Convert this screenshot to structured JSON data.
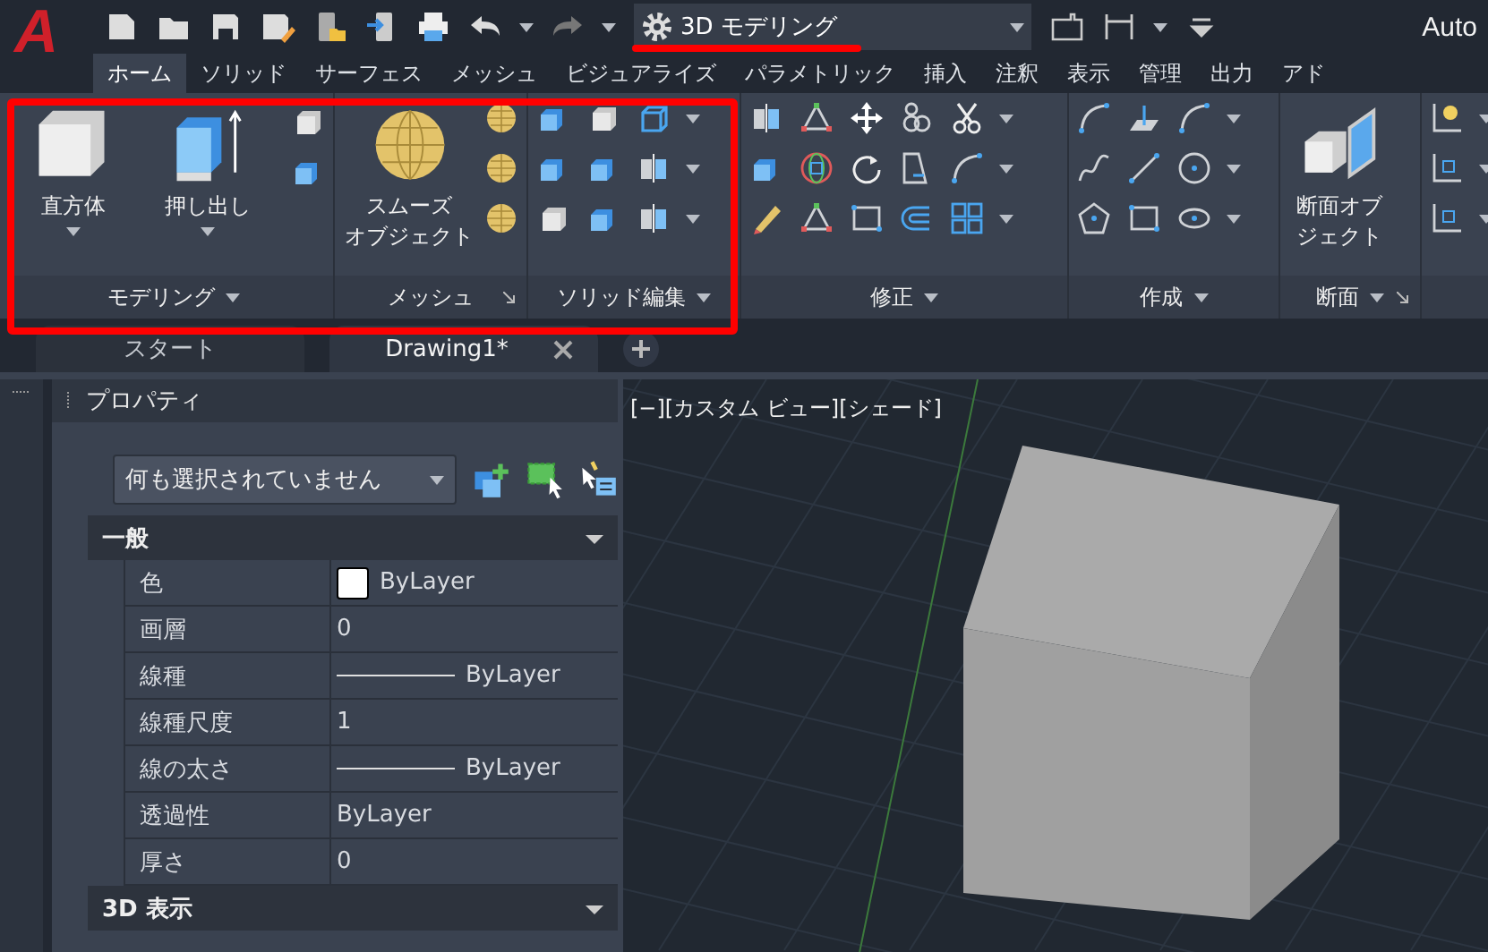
{
  "app_logo": "A",
  "workspace": {
    "value": "3D モデリング"
  },
  "title": "Auto",
  "ribbon_tabs": [
    {
      "label": "ホーム",
      "selected": true
    },
    {
      "label": "ソリッド",
      "selected": false
    },
    {
      "label": "サーフェス",
      "selected": false
    },
    {
      "label": "メッシュ",
      "selected": false
    },
    {
      "label": "ビジュアライズ",
      "selected": false
    },
    {
      "label": "パラメトリック",
      "selected": false
    },
    {
      "label": "挿入",
      "selected": false
    },
    {
      "label": "注釈",
      "selected": false
    },
    {
      "label": "表示",
      "selected": false
    },
    {
      "label": "管理",
      "selected": false
    },
    {
      "label": "出力",
      "selected": false
    },
    {
      "label": "アド",
      "selected": false
    }
  ],
  "ribbon_panels": [
    {
      "title": "モデリング",
      "menu": true,
      "launcher": false,
      "buttons": [
        {
          "label": "直方体",
          "dropdown": true
        },
        {
          "label": "押し出し",
          "dropdown": true
        }
      ]
    },
    {
      "title": "メッシュ",
      "menu": false,
      "launcher": true,
      "buttons": [
        {
          "lines": [
            "スムーズ",
            "オブジェクト"
          ],
          "dropdown": false
        }
      ]
    },
    {
      "title": "ソリッド編集",
      "menu": true,
      "launcher": false
    },
    {
      "title": "修正",
      "menu": true,
      "launcher": false
    },
    {
      "title": "作成",
      "menu": true,
      "launcher": false
    },
    {
      "title": "断面",
      "menu": true,
      "launcher": true,
      "buttons": [
        {
          "lines": [
            "断面オブ",
            "ジェクト"
          ],
          "dropdown": false
        }
      ]
    }
  ],
  "doc_tabs": [
    {
      "label": "スタート",
      "selected": false,
      "closable": false
    },
    {
      "label": "Drawing1*",
      "selected": true,
      "closable": true
    }
  ],
  "properties": {
    "title": "プロパティ",
    "selection": "何も選択されていません",
    "sections": [
      {
        "title": "一般",
        "expanded": true,
        "rows": [
          {
            "label": "色",
            "value": "ByLayer",
            "kind": "color"
          },
          {
            "label": "画層",
            "value": "0",
            "kind": "text"
          },
          {
            "label": "線種",
            "value": "ByLayer",
            "kind": "linetype"
          },
          {
            "label": "線種尺度",
            "value": "1",
            "kind": "text"
          },
          {
            "label": "線の太さ",
            "value": "ByLayer",
            "kind": "linetype"
          },
          {
            "label": "透過性",
            "value": "ByLayer",
            "kind": "text"
          },
          {
            "label": "厚さ",
            "value": "0",
            "kind": "text"
          }
        ]
      },
      {
        "title": "3D 表示",
        "expanded": true
      }
    ]
  },
  "viewport": {
    "label": "[−][カスタム ビュー][シェード]"
  }
}
